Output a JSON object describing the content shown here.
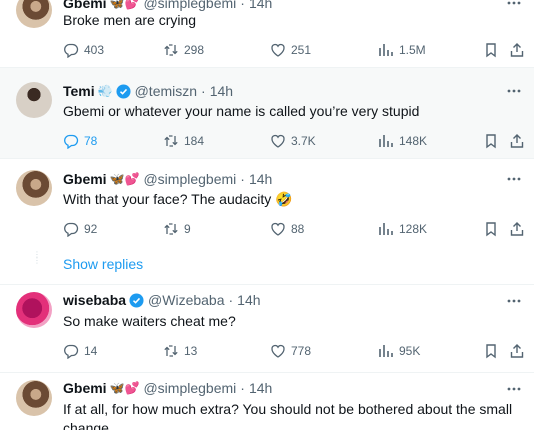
{
  "tweets": [
    {
      "name": "Gbemi",
      "emoji": "🦋💕",
      "handle": "@simplegbemi",
      "time": "14h",
      "text": "Broke men are crying",
      "replies": "403",
      "retweets": "298",
      "likes": "251",
      "views": "1.5M"
    },
    {
      "name": "Temi",
      "emoji": "💨",
      "handle": "@temiszn",
      "time": "14h",
      "text": "Gbemi or whatever your name is called you’re very stupid",
      "replies": "78",
      "retweets": "184",
      "likes": "3.7K",
      "views": "148K"
    },
    {
      "name": "Gbemi",
      "emoji": "🦋💕",
      "handle": "@simplegbemi",
      "time": "14h",
      "text": "With that your face? The audacity 🤣",
      "replies": "92",
      "retweets": "9",
      "likes": "88",
      "views": "128K"
    },
    {
      "name": "wisebaba",
      "emoji": "",
      "handle": "@Wizebaba",
      "time": "14h",
      "text": "So make waiters cheat me?",
      "replies": "14",
      "retweets": "13",
      "likes": "778",
      "views": "95K"
    },
    {
      "name": "Gbemi",
      "emoji": "🦋💕",
      "handle": "@simplegbemi",
      "time": "14h",
      "text": "If at all, for how much extra? You should not be bothered about the small change."
    }
  ],
  "show_replies_label": "Show replies",
  "separator": "·",
  "colors": {
    "accent": "#1d9bf0",
    "secondary_text": "#536471",
    "highlight_bg": "#f7f9f9"
  }
}
